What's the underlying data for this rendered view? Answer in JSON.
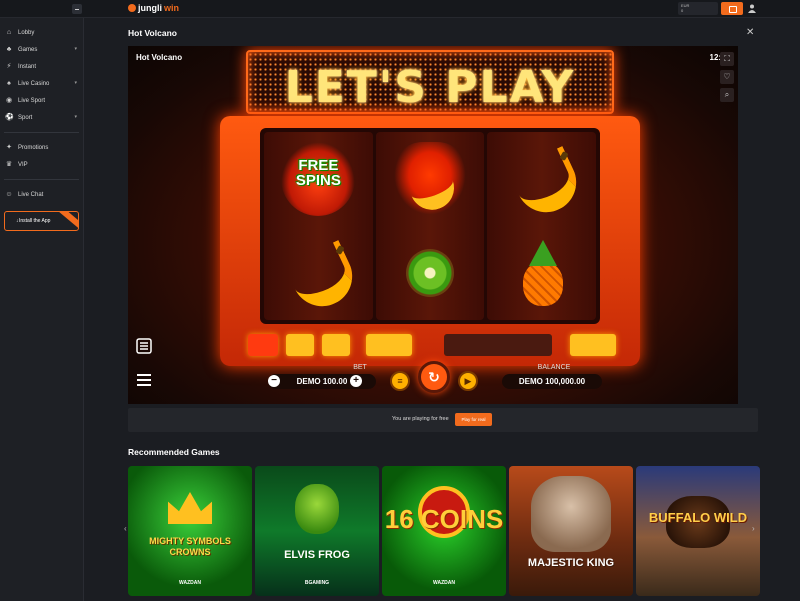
{
  "header": {
    "logo_text_1": "jungli",
    "logo_text_2": "win",
    "wallet_line_1": "EUR",
    "wallet_line_2": "0"
  },
  "sidebar": {
    "items": [
      {
        "label": "Lobby",
        "icon": "lobby-icon"
      },
      {
        "label": "Games",
        "icon": "games-icon"
      },
      {
        "label": "Instant",
        "icon": "instant-icon"
      },
      {
        "label": "Live Casino",
        "icon": "live-casino-icon"
      },
      {
        "label": "Live Sport",
        "icon": "live-sport-icon"
      },
      {
        "label": "Sport",
        "icon": "sport-icon"
      },
      {
        "label": "Promotions",
        "icon": "promotions-icon"
      },
      {
        "label": "VIP",
        "icon": "vip-icon"
      },
      {
        "label": "Live Chat",
        "icon": "chat-icon"
      }
    ],
    "install_label": "Install the App"
  },
  "game": {
    "title": "Hot Volcano",
    "frame_title": "Hot Volcano",
    "clock": "12:43",
    "marquee": "LET'S PLAY",
    "free_spins_line_1": "FREE",
    "free_spins_line_2": "SPINS",
    "bet_label": "BET",
    "bet_value": "DEMO 100.00",
    "balance_label": "BALANCE",
    "balance_value": "DEMO 100,000.00"
  },
  "free_play": {
    "text": "You are playing for free",
    "button": "Play for real"
  },
  "recommended": {
    "title": "Recommended Games",
    "games": [
      {
        "name": "MIGHTY SYMBOLS CROWNS",
        "provider": "WAZDAN"
      },
      {
        "name": "ELVIS FROG",
        "provider": "BGAMING"
      },
      {
        "name": "16 COINS",
        "provider": "WAZDAN"
      },
      {
        "name": "MAJESTIC KING",
        "provider": ""
      },
      {
        "name": "BUFFALO WILD",
        "provider": ""
      }
    ]
  },
  "colors": {
    "brand": "#f26b1d",
    "background": "#1b1d22",
    "sidebar": "#1e2025"
  }
}
